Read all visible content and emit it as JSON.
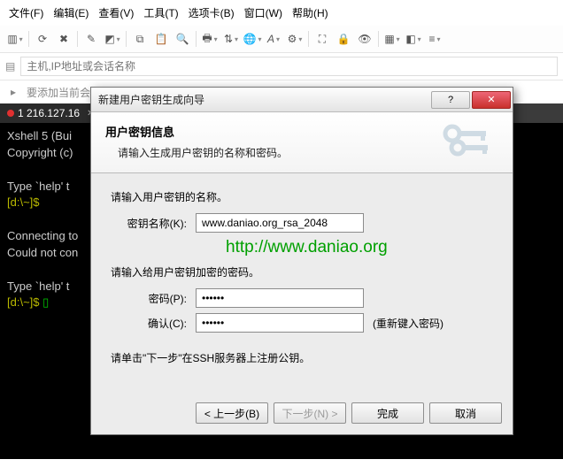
{
  "menu": {
    "file": "文件(F)",
    "edit": "编辑(E)",
    "view": "查看(V)",
    "tools": "工具(T)",
    "tabs": "选项卡(B)",
    "window": "窗口(W)",
    "help": "帮助(H)"
  },
  "addr": {
    "placeholder": "主机,IP地址或会话名称"
  },
  "rail": {
    "text": "要添加当前会话，点击左侧的箭头按钮。"
  },
  "tab": {
    "label": "1 216.127.16"
  },
  "term": {
    "l1": "Xshell 5 (Bui",
    "l2": "Copyright (c)",
    "l3": "Type `help' t",
    "l4": "[d:\\~]$",
    "l5": "Connecting to",
    "l6": "Could not con",
    "l7": "Type `help' t",
    "l8": "[d:\\~]$ "
  },
  "dlg": {
    "title": "新建用户密钥生成向导",
    "banner_title": "用户密钥信息",
    "banner_sub": "请输入生成用户密钥的名称和密码。",
    "prompt_name": "请输入用户密钥的名称。",
    "label_name": "密钥名称(K):",
    "value_name": "www.daniao.org_rsa_2048",
    "watermark": "http://www.daniao.org",
    "prompt_pass": "请输入给用户密钥加密的密码。",
    "label_pass": "密码(P):",
    "value_pass": "••••••",
    "label_conf": "确认(C):",
    "value_conf": "••••••",
    "hint_conf": "(重新键入密码)",
    "info": "请单击\"下一步\"在SSH服务器上注册公钥。",
    "btn_back": "< 上一步(B)",
    "btn_next": "下一步(N) >",
    "btn_finish": "完成",
    "btn_cancel": "取消"
  }
}
